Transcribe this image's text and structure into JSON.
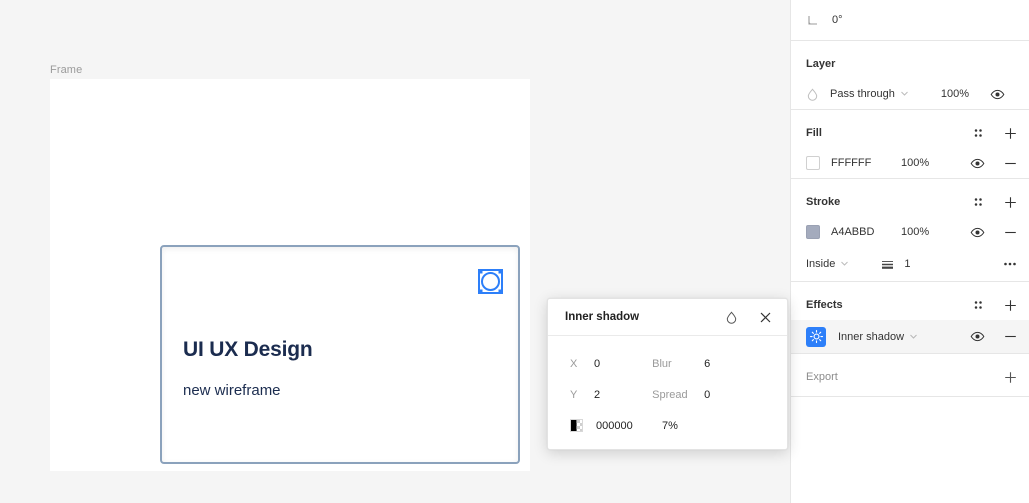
{
  "canvas": {
    "frame_label": "Frame",
    "card": {
      "title": "UI UX Design",
      "subtitle": "new wireframe",
      "shape_icon": "selected-ellipse-icon"
    }
  },
  "panel": {
    "angle": {
      "icon": "corner-angle-icon",
      "value": "0°"
    },
    "layer": {
      "title": "Layer",
      "blend_icon": "blend-mode-icon",
      "blend_mode": "Pass through",
      "opacity": "100%",
      "visibility_icon": "eye-icon",
      "chevron_icon": "chevron-down-icon"
    },
    "fill": {
      "title": "Fill",
      "style_icon": "apply-styles-icon",
      "add_icon": "plus-icon",
      "items": [
        {
          "color": "FFFFFF",
          "swatch_hex": "#FFFFFF",
          "opacity": "100%",
          "visibility_icon": "eye-icon",
          "remove_icon": "minus-icon"
        }
      ]
    },
    "stroke": {
      "title": "Stroke",
      "style_icon": "apply-styles-icon",
      "add_icon": "plus-icon",
      "items": [
        {
          "color": "A4ABBD",
          "swatch_hex": "#A4ABBD",
          "opacity": "100%",
          "visibility_icon": "eye-icon",
          "remove_icon": "minus-icon"
        }
      ],
      "align": "Inside",
      "align_chevron_icon": "chevron-down-icon",
      "weight_icon": "stroke-weight-icon",
      "weight": "1",
      "more_icon": "ellipsis-icon"
    },
    "effects": {
      "title": "Effects",
      "style_icon": "apply-styles-icon",
      "add_icon": "plus-icon",
      "items": [
        {
          "icon": "effect-sun-icon",
          "icon_bg": "#2D7FF9",
          "name": "Inner shadow",
          "chevron_icon": "chevron-down-icon",
          "visibility_icon": "eye-icon",
          "remove_icon": "minus-icon",
          "selected": true
        }
      ]
    },
    "export": {
      "title": "Export",
      "add_icon": "plus-icon"
    }
  },
  "dialog": {
    "title": "Inner shadow",
    "blend_icon": "blend-mode-icon",
    "close_icon": "close-icon",
    "fields": {
      "x_label": "X",
      "x_value": "0",
      "y_label": "Y",
      "y_value": "2",
      "blur_label": "Blur",
      "blur_value": "6",
      "spread_label": "Spread",
      "spread_value": "0",
      "color_hex": "000000",
      "color_opacity": "7%"
    }
  }
}
